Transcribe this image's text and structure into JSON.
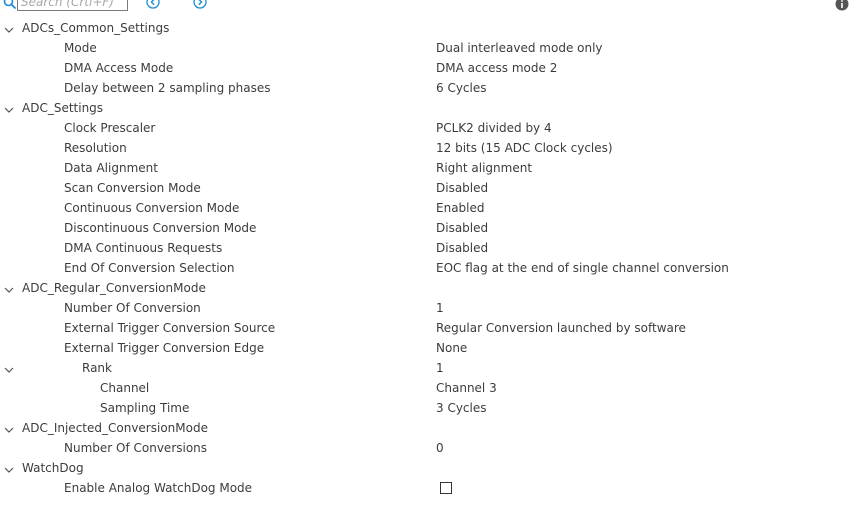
{
  "search": {
    "placeholder": "Search (Crtl+F)"
  },
  "icons": {
    "search": "search-icon",
    "prev": "arrow-left-circle-icon",
    "next": "arrow-right-circle-icon",
    "info": "info-icon",
    "expand": "chevron-down-icon"
  },
  "colors": {
    "accent": "#1e8cd2",
    "text": "#3c3c3c",
    "info": "#555555"
  },
  "tree": {
    "common": {
      "label": "ADCs_Common_Settings",
      "mode": {
        "label": "Mode",
        "value": "Dual interleaved mode only"
      },
      "dma_access": {
        "label": "DMA Access Mode",
        "value": "DMA access mode 2"
      },
      "delay": {
        "label": "Delay between 2 sampling phases",
        "value": "6 Cycles"
      }
    },
    "adc": {
      "label": "ADC_Settings",
      "clock": {
        "label": "Clock Prescaler",
        "value": "PCLK2 divided by 4"
      },
      "resolution": {
        "label": "Resolution",
        "value": "12 bits (15 ADC Clock cycles)"
      },
      "alignment": {
        "label": "Data Alignment",
        "value": "Right alignment"
      },
      "scan": {
        "label": "Scan Conversion Mode",
        "value": "Disabled"
      },
      "continuous": {
        "label": "Continuous Conversion Mode",
        "value": "Enabled"
      },
      "discontinuous": {
        "label": "Discontinuous Conversion Mode",
        "value": "Disabled"
      },
      "dma_cont": {
        "label": "DMA Continuous Requests",
        "value": "Disabled"
      },
      "eoc": {
        "label": "End Of Conversion Selection",
        "value": "EOC flag at the end of single channel conversion"
      }
    },
    "regular": {
      "label": "ADC_Regular_ConversionMode",
      "num": {
        "label": "Number Of Conversion",
        "value": "1"
      },
      "ext_src": {
        "label": "External Trigger Conversion Source",
        "value": "Regular Conversion launched by software"
      },
      "ext_edge": {
        "label": "External Trigger Conversion Edge",
        "value": "None"
      },
      "rank": {
        "label": "Rank",
        "value": "1"
      },
      "channel": {
        "label": "Channel",
        "value": "Channel 3"
      },
      "sampling": {
        "label": "Sampling Time",
        "value": "3 Cycles"
      }
    },
    "injected": {
      "label": "ADC_Injected_ConversionMode",
      "num": {
        "label": "Number Of Conversions",
        "value": "0"
      }
    },
    "watchdog": {
      "label": "WatchDog",
      "enable": {
        "label": "Enable Analog WatchDog Mode",
        "checked": false
      }
    }
  }
}
